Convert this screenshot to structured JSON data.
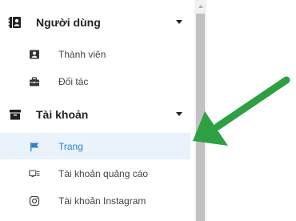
{
  "sidebar": {
    "groups": [
      {
        "label": "Người dùng",
        "icon": "address-book-icon",
        "items": [
          {
            "label": "Thành viên",
            "icon": "id-card-icon",
            "active": false
          },
          {
            "label": "Đối tác",
            "icon": "briefcase-icon",
            "active": false
          }
        ]
      },
      {
        "label": "Tài khoản",
        "icon": "archive-icon",
        "items": [
          {
            "label": "Trang",
            "icon": "flag-icon",
            "active": true
          },
          {
            "label": "Tài khoản quảng cáo",
            "icon": "ad-icon",
            "active": false
          },
          {
            "label": "Tài khoản Instagram",
            "icon": "instagram-icon",
            "active": false
          }
        ]
      }
    ]
  },
  "colors": {
    "active_text": "#2f80c7",
    "active_bg": "#eaf3fb",
    "arrow": "#2ea043",
    "scroll_thumb": "#c1c1c1"
  }
}
